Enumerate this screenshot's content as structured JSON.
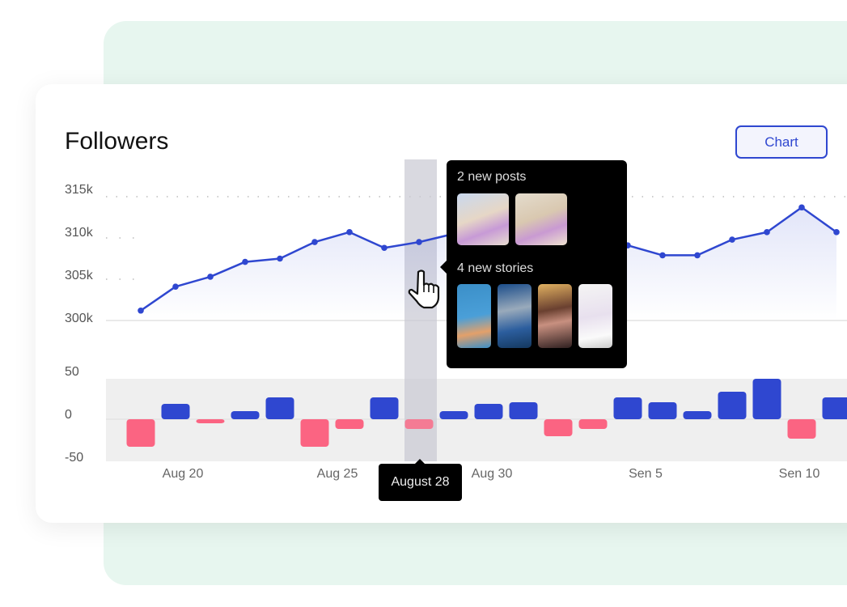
{
  "header": {
    "title": "Followers",
    "chart_button": "Chart"
  },
  "tooltip": {
    "posts_label": "2 new posts",
    "stories_label": "4 new stories",
    "date": "August 28"
  },
  "colors": {
    "line": "#2f47d0",
    "positive_bar": "#2f47d0",
    "negative_bar": "#fb6482",
    "band": "#efefef",
    "highlight": "#c9c9d3",
    "background_panel": "#e7f6ef"
  },
  "icons": {
    "cursor": "hand-pointer-icon"
  },
  "chart_data": [
    {
      "type": "line",
      "y_ticks": [
        "315k",
        "310k",
        "305k",
        "300k"
      ],
      "ylim": [
        300,
        315
      ],
      "y_unit": "k",
      "values": [
        301.2,
        304.1,
        305.3,
        307.1,
        307.5,
        309.5,
        310.7,
        308.8,
        309.5,
        310.5,
        311.5,
        312,
        311,
        310,
        309.1,
        307.9,
        307.9,
        309.8,
        310.7,
        313.7,
        310.7
      ],
      "area_fill": true
    },
    {
      "type": "bar",
      "y_ticks": [
        "50",
        "0",
        "-50"
      ],
      "ylim": [
        -50,
        50
      ],
      "values": [
        -34,
        19,
        -5,
        10,
        27,
        -34,
        -12,
        27,
        -12,
        10,
        19,
        21,
        -21,
        -12,
        27,
        21,
        10,
        34,
        50,
        -24,
        27
      ],
      "x_ticks": [
        "Aug 20",
        "Aug 25",
        "Aug 30",
        "Sen 5",
        "Sen 10"
      ],
      "highlighted_index": 8
    }
  ]
}
